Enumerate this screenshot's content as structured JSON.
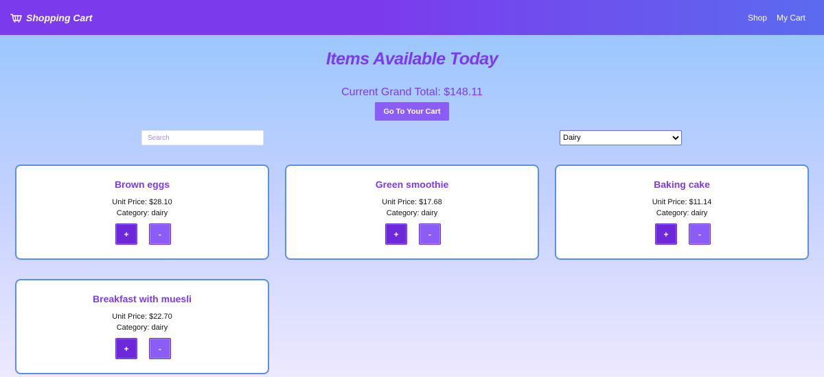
{
  "navbar": {
    "brand_title": "Shopping Cart",
    "brand_icon": "basket-icon",
    "links": [
      "Shop",
      "My Cart"
    ]
  },
  "main": {
    "title": "Items Available Today",
    "grand_total": "Current Grand Total: $148.11",
    "cart_button_label": "Go To Your Cart"
  },
  "filters": {
    "search_placeholder": "Search",
    "search_value": "",
    "category_selected": "Dairy"
  },
  "products": [
    {
      "name": "Brown eggs",
      "price": "Unit Price: $28.10",
      "category": "Category: dairy",
      "add_label": "+",
      "remove_label": "-"
    },
    {
      "name": "Green smoothie",
      "price": "Unit Price: $17.68",
      "category": "Category: dairy",
      "add_label": "+",
      "remove_label": "-"
    },
    {
      "name": "Baking cake",
      "price": "Unit Price: $11.14",
      "category": "Category: dairy",
      "add_label": "+",
      "remove_label": "-"
    },
    {
      "name": "Breakfast with muesli",
      "price": "Unit Price: $22.70",
      "category": "Category: dairy",
      "add_label": "+",
      "remove_label": "-"
    }
  ],
  "colors": {
    "accent": "#7c3aed",
    "button_primary": "#8b5cf6",
    "button_dark": "#6d28d9",
    "card_border": "#5b8def",
    "nav_gradient_start": "#7c3aed",
    "nav_gradient_end": "#5b6bef"
  }
}
